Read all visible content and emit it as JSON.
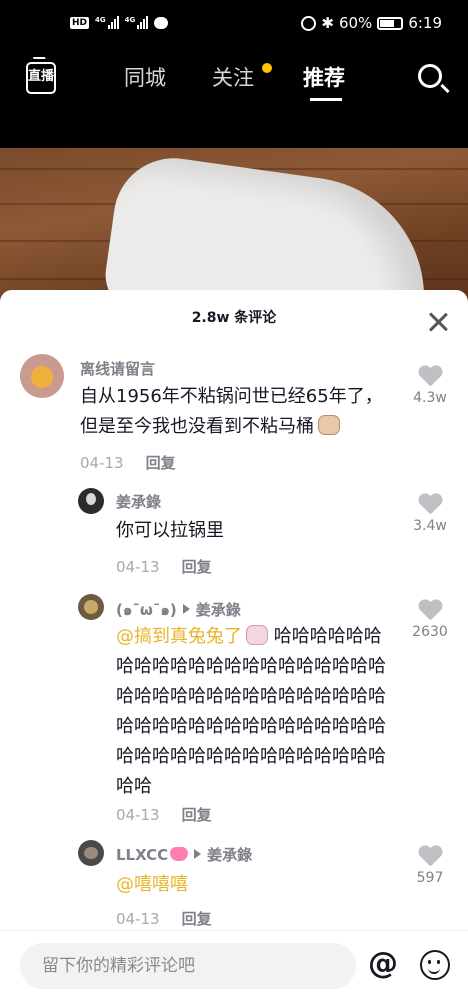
{
  "status_bar": {
    "left_icons": [
      "hd-icon",
      "4g-signal-icon",
      "4g-signal-icon",
      "chat-bubble-icon"
    ],
    "hd_label": "HD",
    "net_label": "4G",
    "battery_percent": "60%",
    "time": "6:19"
  },
  "top_nav": {
    "live_label": "直播",
    "tabs": [
      "同城",
      "关注",
      "推荐"
    ],
    "active_tab": "推荐"
  },
  "panel": {
    "title": "2.8w 条评论"
  },
  "comments": [
    {
      "user": "离线请留言",
      "text_line1": "自从1956年不粘锅问世已经65年了，",
      "text_line2": "但是至今我也没看到不粘马桶",
      "emoji": "cat-face-emoji",
      "date": "04-13",
      "reply_label": "回复",
      "likes": "4.3w"
    },
    {
      "user": "姜承錄",
      "text": "你可以拉锅里",
      "date": "04-13",
      "reply_label": "回复",
      "likes": "3.4w"
    },
    {
      "user": "(๑¯ω¯๑)",
      "reply_to": "姜承錄",
      "mention": "@搞到真兔兔了",
      "emoji": "bunny-emoji",
      "text_line1": " 哈哈哈哈哈哈",
      "text_line2": "哈哈哈哈哈哈哈哈哈哈哈哈哈哈哈",
      "text_line3": "哈哈哈哈哈哈哈哈哈哈哈哈哈哈哈",
      "text_line4": "哈哈哈哈哈哈哈哈哈哈哈哈哈哈哈",
      "text_line5": "哈哈哈哈哈哈哈哈哈哈哈哈哈哈哈",
      "text_line6": "哈哈",
      "date": "04-13",
      "reply_label": "回复",
      "likes": "2630"
    },
    {
      "user": "LLXCC",
      "user_emoji": "pink-heart-emoji",
      "reply_to": "姜承錄",
      "mention": "@嘻嘻嘻",
      "date": "04-13",
      "reply_label": "回复",
      "likes": "597"
    }
  ],
  "input_bar": {
    "placeholder": "留下你的精彩评论吧"
  },
  "colors": {
    "mention": "#e8b42a",
    "follow_dot": "#ffc300",
    "muted_text": "#80808a"
  }
}
